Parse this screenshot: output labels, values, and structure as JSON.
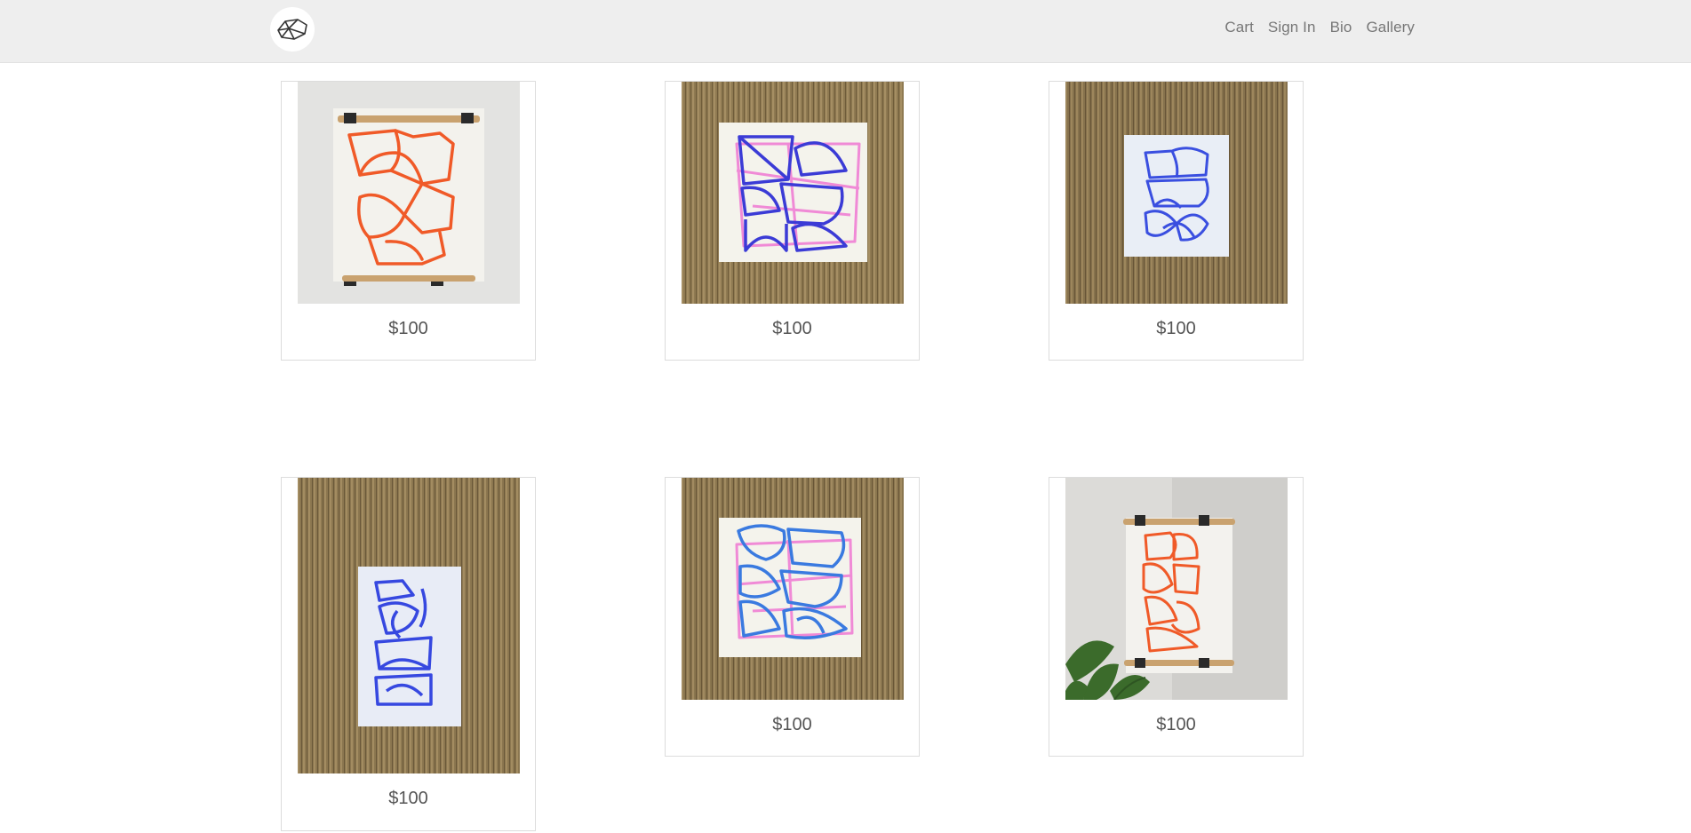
{
  "header": {
    "logo_icon": "sketch-shapes-logo-icon",
    "nav": [
      {
        "label": "Cart"
      },
      {
        "label": "Sign In"
      },
      {
        "label": "Bio"
      },
      {
        "label": "Gallery"
      }
    ]
  },
  "products": [
    {
      "price": "$100",
      "artwork": "orange line drawing on paper hung on white wall",
      "ink": "#f05a28",
      "background": "wall"
    },
    {
      "price": "$100",
      "artwork": "blue and pink line drawing on jute rug",
      "ink": "#3b3bd6",
      "ink2": "#f08ad6",
      "background": "jute"
    },
    {
      "price": "$100",
      "artwork": "blue line drawing on jute rug",
      "ink": "#3a4fe0",
      "background": "jute"
    },
    {
      "price": "$100",
      "artwork": "blue line drawing on paper over jute rug",
      "ink": "#3648e0",
      "background": "jute"
    },
    {
      "price": "$100",
      "artwork": "blue and pink line drawing on jute rug",
      "ink": "#3a7ae0",
      "ink2": "#f08ad6",
      "background": "jute"
    },
    {
      "price": "$100",
      "artwork": "orange line drawing hung on wall with plant",
      "ink": "#f05a28",
      "background": "wall-plant"
    }
  ]
}
